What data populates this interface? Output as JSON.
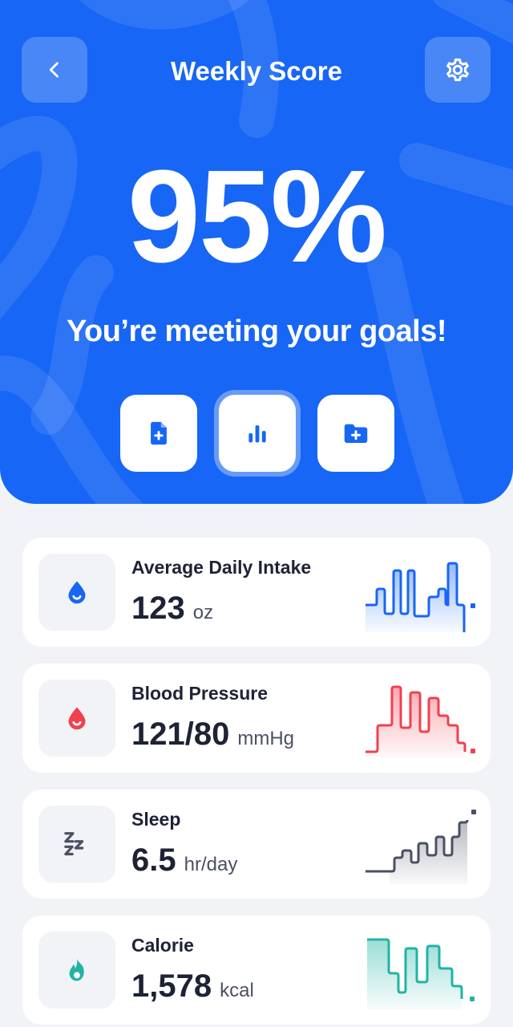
{
  "header": {
    "title": "Weekly Score",
    "back_icon": "chevron-left-icon",
    "settings_icon": "gear-icon"
  },
  "score": {
    "value": "95%",
    "message": "You’re meeting your goals!"
  },
  "actions": [
    {
      "icon": "add-document-icon",
      "selected": false
    },
    {
      "icon": "bar-chart-icon",
      "selected": true
    },
    {
      "icon": "add-folder-icon",
      "selected": false
    }
  ],
  "metrics": [
    {
      "label": "Average Daily Intake",
      "value": "123",
      "unit": "oz",
      "icon": "water-drop-icon",
      "color": "#1766f5"
    },
    {
      "label": "Blood Pressure",
      "value": "121/80",
      "unit": "mmHg",
      "icon": "blood-drop-icon",
      "color": "#f0414f"
    },
    {
      "label": "Sleep",
      "value": "6.5",
      "unit": "hr/day",
      "icon": "sleep-zzz-icon",
      "color": "#4b5063"
    },
    {
      "label": "Calorie",
      "value": "1,578",
      "unit": "kcal",
      "icon": "flame-icon",
      "color": "#22b3a6"
    }
  ],
  "colors": {
    "primary": "#1766f5",
    "background": "#f1f3f6"
  }
}
